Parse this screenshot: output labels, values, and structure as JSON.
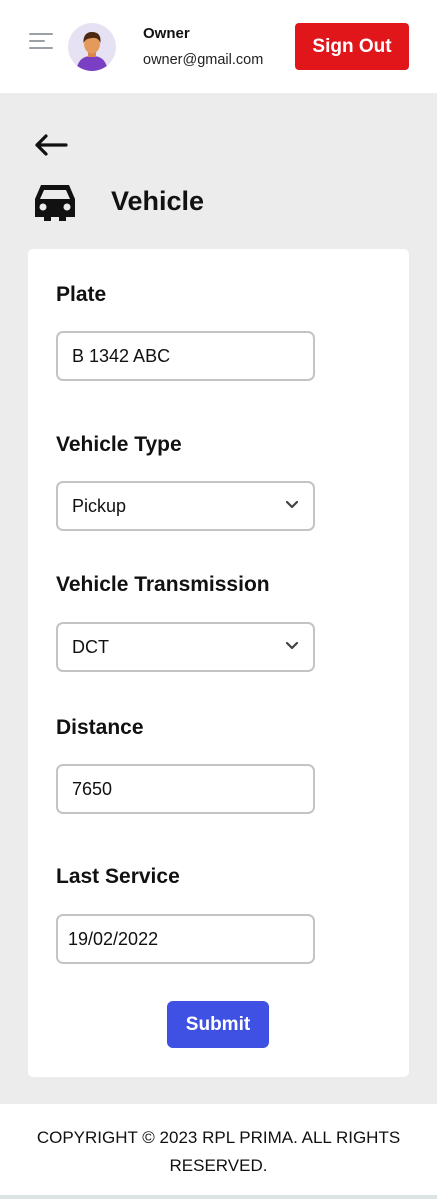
{
  "header": {
    "user_name": "Owner",
    "user_email": "owner@gmail.com",
    "signout_label": "Sign Out"
  },
  "page": {
    "title": "Vehicle"
  },
  "form": {
    "plate_label": "Plate",
    "plate_value": "B 1342 ABC",
    "type_label": "Vehicle Type",
    "type_value": "Pickup",
    "transmission_label": "Vehicle Transmission",
    "transmission_value": "DCT",
    "distance_label": "Distance",
    "distance_value": "7650",
    "service_label": "Last Service",
    "service_value": "19/02/2022",
    "submit_label": "Submit"
  },
  "footer": {
    "copyright": "COPYRIGHT © 2023 RPL PRIMA. ALL RIGHTS RESERVED."
  },
  "colors": {
    "signout": "#e0161b",
    "submit": "#3f51e3",
    "background": "#ececec"
  },
  "icons": [
    "menu-icon",
    "avatar",
    "back-arrow-icon",
    "car-icon",
    "chevron-down-icon"
  ]
}
